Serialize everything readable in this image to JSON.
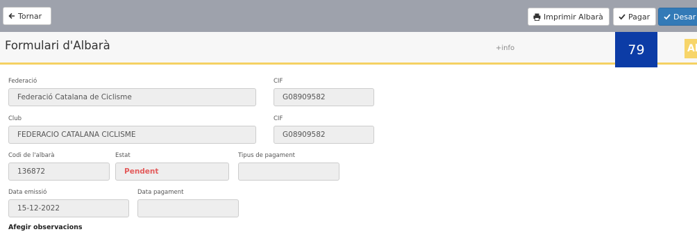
{
  "toolbar": {
    "back_label": "Tornar",
    "print_label": "Imprimir Albarà",
    "pay_label": "Pagar",
    "save_label": "Desar"
  },
  "header": {
    "title": "Formulari d'Albarà",
    "info_link": "+info",
    "counter": "79",
    "tab_text": "Al"
  },
  "form": {
    "federacio": {
      "label": "Federació",
      "value": "Federació Catalana de Ciclisme"
    },
    "federacio_cif": {
      "label": "CIF",
      "value": "G08909582"
    },
    "club": {
      "label": "Club",
      "value": "FEDERACIO CATALANA CICLISME"
    },
    "club_cif": {
      "label": "CIF",
      "value": "G08909582"
    },
    "codi": {
      "label": "Codi de l'albarà",
      "value": "136872"
    },
    "estat": {
      "label": "Estat",
      "value": "Pendent"
    },
    "tipus_pagament": {
      "label": "Tipus de pagament",
      "value": ""
    },
    "data_emissio": {
      "label": "Data emissió",
      "value": "15-12-2022"
    },
    "data_pagament": {
      "label": "Data pagament",
      "value": ""
    },
    "observacions_label": "Afegir observacions"
  },
  "colors": {
    "toolbar_bg": "#9ea2ac",
    "accent_blue": "#337ab7",
    "counter_bg": "#0c3ca6",
    "header_underline": "#f5d163",
    "status_pending": "#e35b5b"
  },
  "icons": {
    "back": "arrow-left-icon",
    "print": "printer-icon",
    "pay": "check-icon",
    "save": "check-icon"
  }
}
